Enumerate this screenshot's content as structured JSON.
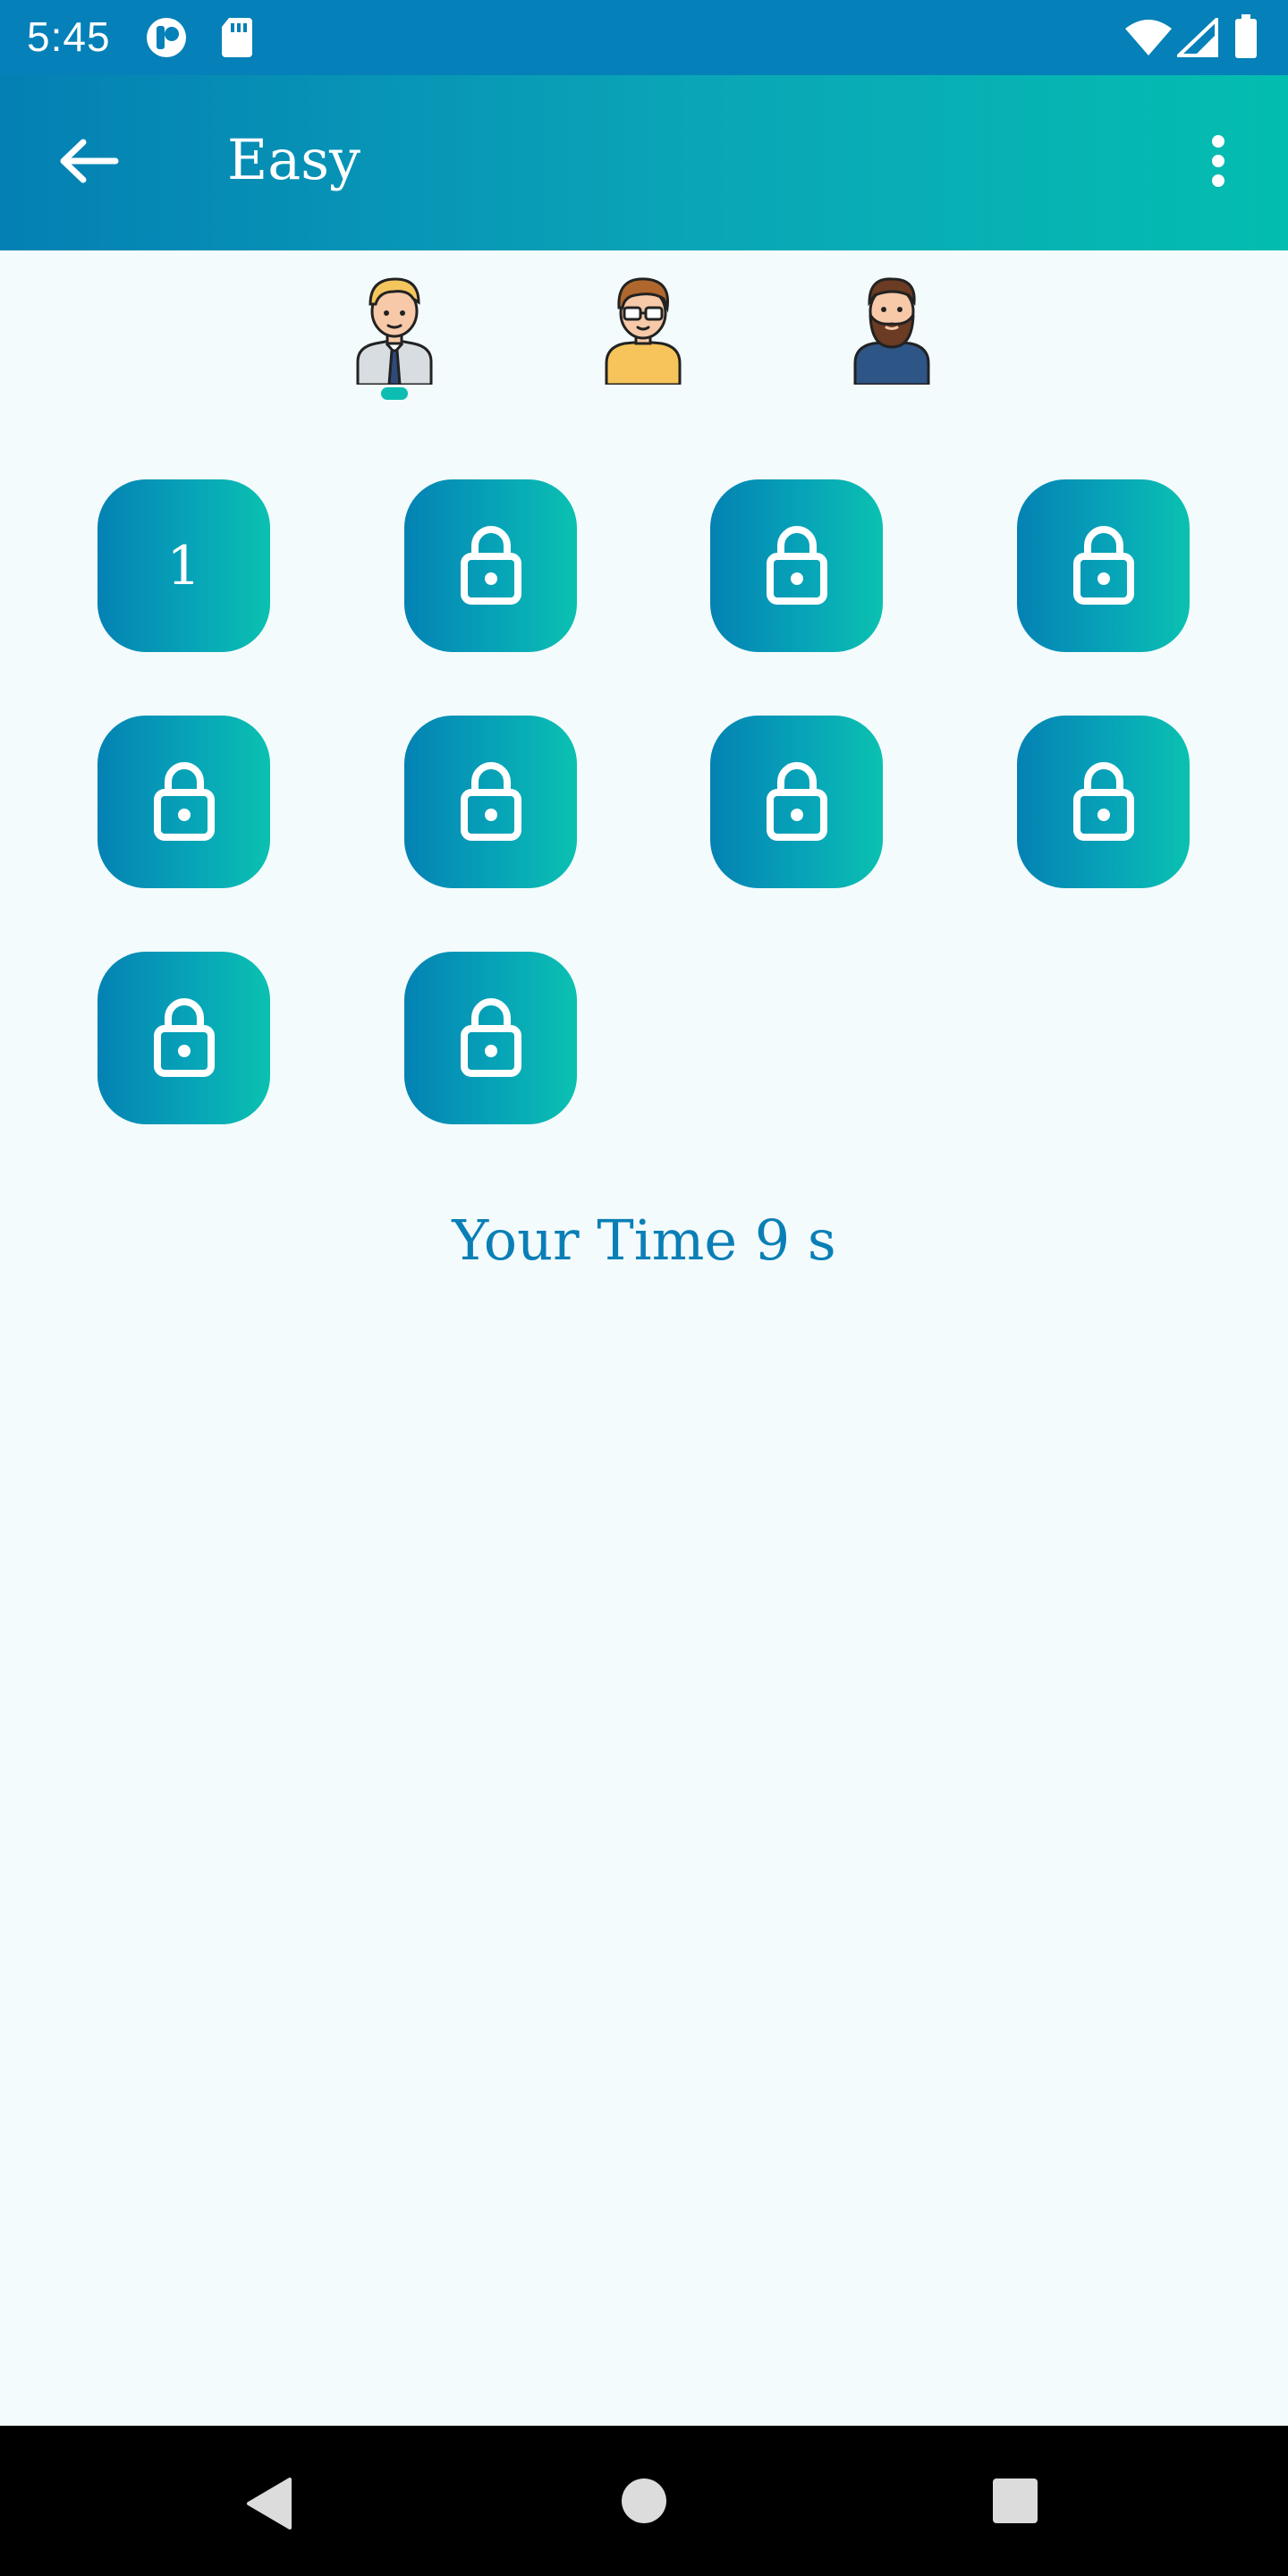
{
  "status_bar": {
    "time": "5:45",
    "icons": [
      "app-notification-icon",
      "sd-card-icon",
      "wifi-icon",
      "cell-signal-icon",
      "battery-icon"
    ]
  },
  "app_bar": {
    "title": "Easy",
    "back_icon": "arrow-back-icon",
    "menu_icon": "more-vert-icon",
    "gradient": [
      "#0480b4",
      "#03bdb0"
    ]
  },
  "avatars": [
    {
      "name": "businessman-avatar",
      "selected": true
    },
    {
      "name": "glasses-man-avatar",
      "selected": false
    },
    {
      "name": "bearded-man-avatar",
      "selected": false
    }
  ],
  "levels": [
    {
      "label": "1",
      "locked": false
    },
    {
      "label": "",
      "locked": true
    },
    {
      "label": "",
      "locked": true
    },
    {
      "label": "",
      "locked": true
    },
    {
      "label": "",
      "locked": true
    },
    {
      "label": "",
      "locked": true
    },
    {
      "label": "",
      "locked": true
    },
    {
      "label": "",
      "locked": true
    },
    {
      "label": "",
      "locked": true
    },
    {
      "label": "",
      "locked": true
    }
  ],
  "your_time": "Your Time 9 s",
  "colors": {
    "accent": "#0a7fb6",
    "teal": "#0dbdb1",
    "background": "#f3fbfd"
  },
  "nav_bar": {
    "icons": [
      "back-triangle-icon",
      "home-circle-icon",
      "recents-square-icon"
    ]
  }
}
